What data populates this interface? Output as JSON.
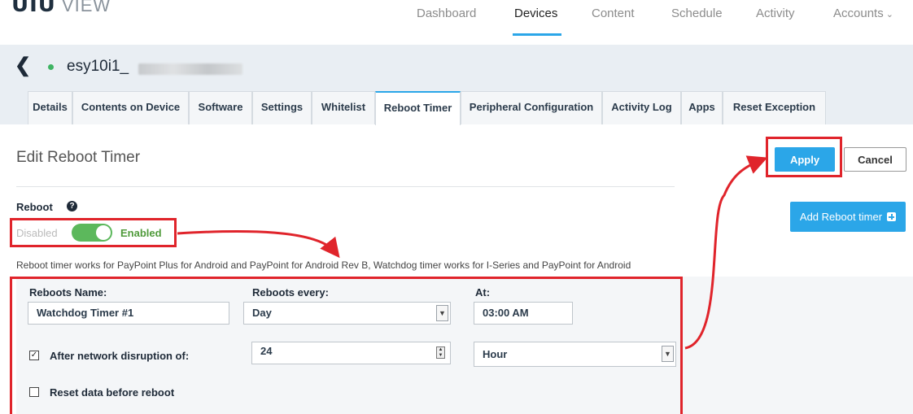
{
  "logo": {
    "main": "UIU",
    "sub": "VIEW"
  },
  "nav": {
    "items": [
      {
        "label": "Dashboard"
      },
      {
        "label": "Devices"
      },
      {
        "label": "Content"
      },
      {
        "label": "Schedule"
      },
      {
        "label": "Activity"
      },
      {
        "label": "Accounts"
      }
    ],
    "active": "Devices"
  },
  "device": {
    "name": "esy10i1_",
    "status_color": "#3fb463"
  },
  "tabs": [
    {
      "label": "Details"
    },
    {
      "label": "Contents on Device"
    },
    {
      "label": "Software"
    },
    {
      "label": "Settings"
    },
    {
      "label": "Whitelist"
    },
    {
      "label": "Reboot Timer"
    },
    {
      "label": "Peripheral Configuration"
    },
    {
      "label": "Activity Log"
    },
    {
      "label": "Apps"
    },
    {
      "label": "Reset Exception"
    }
  ],
  "active_tab": "Reboot Timer",
  "page": {
    "title": "Edit Reboot Timer",
    "apply_label": "Apply",
    "cancel_label": "Cancel",
    "add_timer_label": "Add Reboot timer"
  },
  "reboot": {
    "label": "Reboot",
    "disabled_label": "Disabled",
    "enabled_label": "Enabled",
    "enabled": true
  },
  "info_text": "Reboot timer works for PayPoint Plus for Android and PayPoint for Android Rev B, Watchdog timer works for I-Series and PayPoint for Android",
  "form": {
    "name_label": "Reboots Name:",
    "name_value": "Watchdog Timer #1",
    "every_label": "Reboots every:",
    "every_value": "Day",
    "at_label": "At:",
    "at_value": "03:00 AM",
    "network_label": "After network disruption of:",
    "network_checked": true,
    "network_value": "24",
    "network_unit": "Hour",
    "reset_label": "Reset data before reboot",
    "reset_checked": false
  },
  "colors": {
    "accent": "#2ba6e8",
    "annotation": "#e0242b",
    "toggle_on": "#5cb85c"
  }
}
